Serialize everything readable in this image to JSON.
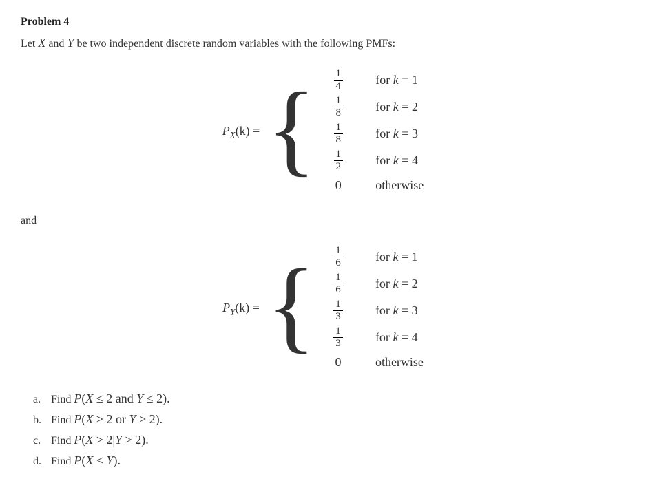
{
  "problem": {
    "title": "Problem 4",
    "intro_pre": "Let ",
    "var_X": "X",
    "intro_mid": " and ",
    "var_Y": "Y",
    "intro_post": " be two independent discrete random variables with the following PMFs:"
  },
  "pmf_X": {
    "label_P": "P",
    "label_sub": "X",
    "label_arg": "(k) = ",
    "rows": [
      {
        "num": "1",
        "den": "4",
        "cond": "for k = 1"
      },
      {
        "num": "1",
        "den": "8",
        "cond": "for k = 2"
      },
      {
        "num": "1",
        "den": "8",
        "cond": "for k = 3"
      },
      {
        "num": "1",
        "den": "2",
        "cond": "for k = 4"
      },
      {
        "plain": "0",
        "cond": "otherwise"
      }
    ]
  },
  "and_text": "and",
  "pmf_Y": {
    "label_P": "P",
    "label_sub": "Y",
    "label_arg": "(k) = ",
    "rows": [
      {
        "num": "1",
        "den": "6",
        "cond": "for k = 1"
      },
      {
        "num": "1",
        "den": "6",
        "cond": "for k = 2"
      },
      {
        "num": "1",
        "den": "3",
        "cond": "for k = 3"
      },
      {
        "num": "1",
        "den": "3",
        "cond": "for k = 4"
      },
      {
        "plain": "0",
        "cond": "otherwise"
      }
    ]
  },
  "questions": {
    "a": {
      "label": "a.",
      "find": "Find ",
      "expr": "P(X ≤ 2 and Y ≤ 2).",
      "period": ""
    },
    "b": {
      "label": "b.",
      "find": "Find ",
      "expr": "P(X > 2 or Y > 2).",
      "period": ""
    },
    "c": {
      "label": "c.",
      "find": "Find ",
      "expr": "P(X > 2|Y > 2).",
      "period": ""
    },
    "d": {
      "label": "d.",
      "find": "Find ",
      "expr": "P(X < Y).",
      "period": ""
    }
  },
  "chart_data": {
    "type": "table",
    "title": "PMFs of independent discrete random variables X and Y",
    "X": {
      "support": [
        1,
        2,
        3,
        4
      ],
      "p": [
        0.25,
        0.125,
        0.125,
        0.5
      ],
      "p_frac": [
        "1/4",
        "1/8",
        "1/8",
        "1/2"
      ]
    },
    "Y": {
      "support": [
        1,
        2,
        3,
        4
      ],
      "p": [
        0.1667,
        0.1667,
        0.3333,
        0.3333
      ],
      "p_frac": [
        "1/6",
        "1/6",
        "1/3",
        "1/3"
      ]
    }
  }
}
